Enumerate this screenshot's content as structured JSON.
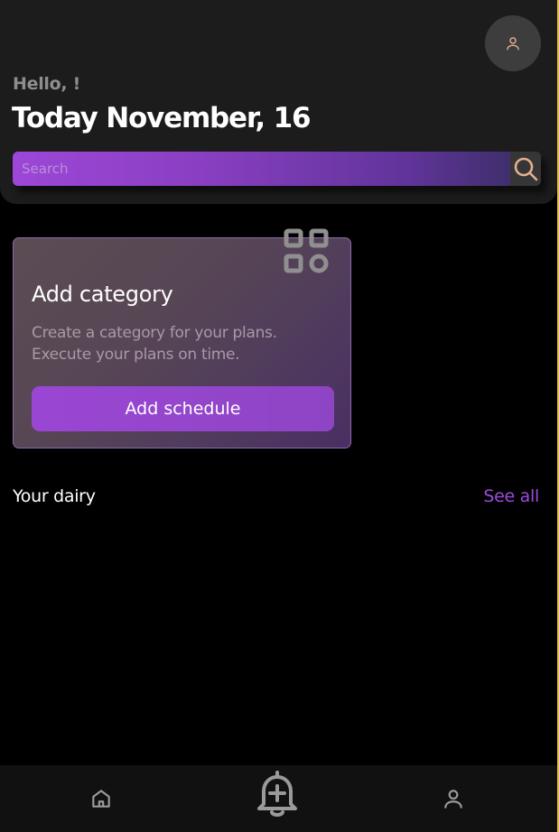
{
  "header": {
    "greeting": "Hello, !",
    "date_title": "Today November, 16",
    "search": {
      "placeholder": "Search"
    }
  },
  "card": {
    "title": "Add category",
    "description": "Create a category for your plans. Execute your plans on time.",
    "button_label": "Add schedule"
  },
  "diary": {
    "title": "Your dairy",
    "see_all_label": "See all"
  },
  "icons": {
    "avatar": "user-icon",
    "search": "search-icon",
    "category": "category-grid-icon",
    "home": "home-icon",
    "add": "bell-plus-icon",
    "profile": "user-icon"
  },
  "colors": {
    "accent": "#9d47d8",
    "see_all": "#9d4adc",
    "header_bg": "#1c1c1c",
    "nav_bg": "#111111"
  }
}
